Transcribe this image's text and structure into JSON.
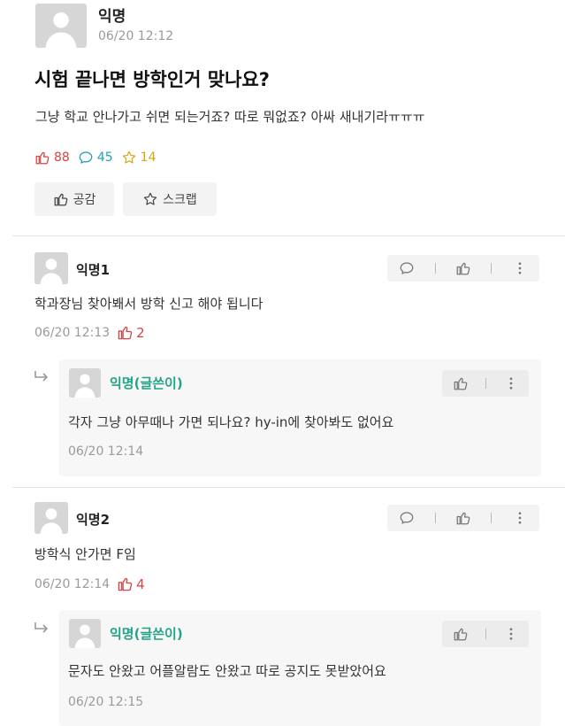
{
  "post": {
    "author": "익명",
    "time": "06/20 12:12",
    "title": "시험 끝나면 방학인거 맞나요?",
    "body": "그냥 학교 안나가고 쉬면 되는거죠? 따로 뭐없죠? 아싸 새내기라ㅠㅠㅠ",
    "likes": "88",
    "comments": "45",
    "scraps": "14",
    "like_button": "공감",
    "scrap_button": "스크랩"
  },
  "comments": [
    {
      "author": "익명1",
      "text": "학과장님 찾아봬서 방학 신고 해야 됩니다",
      "time": "06/20 12:13",
      "votes": "2",
      "reply": {
        "author": "익명(글쓴이)",
        "text": "각자 그냥 아무때나 가면 되나요? hy-in에 찾아봐도 없어요",
        "time": "06/20 12:14"
      }
    },
    {
      "author": "익명2",
      "text": "방학식 안가면 F임",
      "time": "06/20 12:14",
      "votes": "4",
      "reply": {
        "author": "익명(글쓴이)",
        "text": "문자도 안왔고 어플알람도 안왔고 따로 공지도 못받았어요",
        "time": "06/20 12:15"
      }
    }
  ],
  "colors": {
    "like": "#d64545",
    "comment": "#1ea0bd",
    "scrap": "#d4a514",
    "op_name": "#23a38a"
  },
  "icons": [
    "thumbs-up-icon",
    "speech-bubble-icon",
    "star-icon",
    "more-vertical-icon",
    "reply-arrow-icon",
    "default-avatar-icon"
  ]
}
